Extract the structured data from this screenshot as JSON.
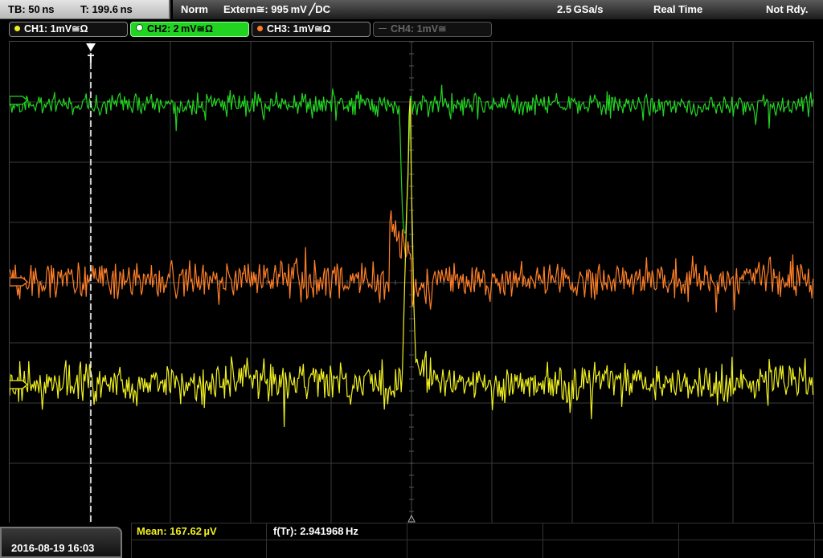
{
  "topbar": {
    "timebase": "TB: 50 ns",
    "trigger_time": "T: 199.6 ns",
    "trigger_mode": "Norm",
    "trigger_source": "Extern≅: 995 mV ╱DC",
    "sample_rate": "2.5 GSa/s",
    "acq_mode": "Real Time",
    "status": "Not Rdy."
  },
  "channels": [
    {
      "label": "CH1: 1mV≅Ω",
      "color": "#f0f020",
      "state": "on"
    },
    {
      "label": "CH2: 2 mV≅Ω",
      "color": "#22d422",
      "state": "active"
    },
    {
      "label": "CH3: 1mV≅Ω",
      "color": "#ff7f27",
      "state": "on"
    },
    {
      "label": "CH4: 1mV≅",
      "color": "#888888",
      "state": "off"
    }
  ],
  "measurements": {
    "mean": "Mean: 167.62 µV",
    "freq": "f(Tr): 2.941968 Hz"
  },
  "date": "2016-08-19 16:03",
  "colors": {
    "ch1": "#f0f020",
    "ch2": "#22d422",
    "ch3": "#ff7f27",
    "grid": "#3a3a3a",
    "meas_text": "#f0f020"
  },
  "icons": {
    "trigger_marker": "trigger-position-icon",
    "ch1_marker": "ch1-offset-marker-icon",
    "ch2_marker": "ch2-offset-marker-icon",
    "ch3_marker": "ch3-offset-marker-icon"
  }
}
